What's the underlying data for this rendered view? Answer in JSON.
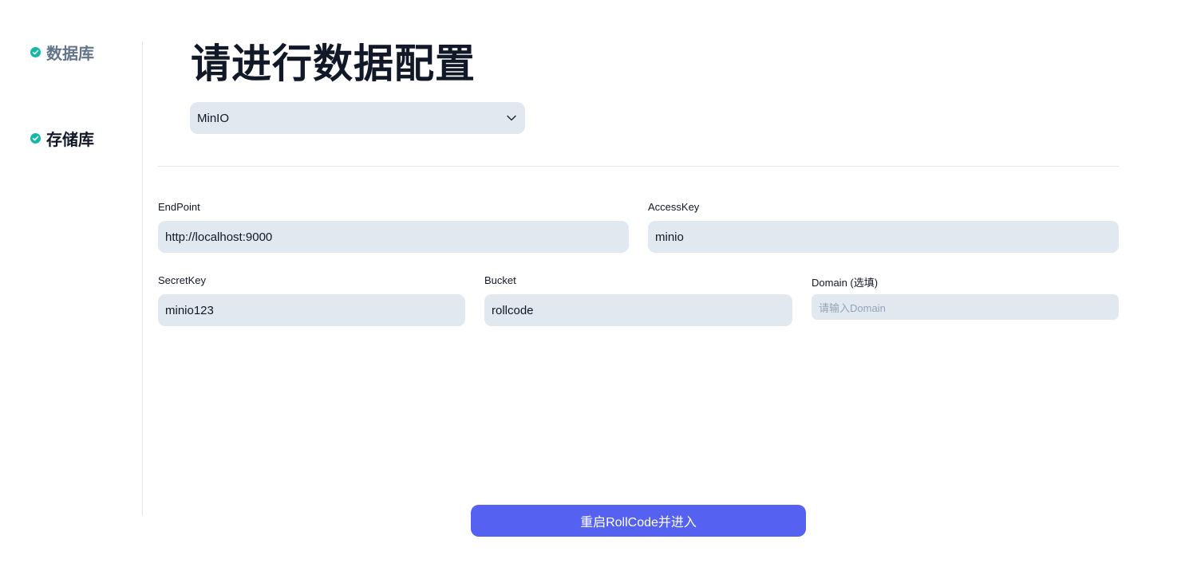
{
  "steps": [
    {
      "label": "数据库"
    },
    {
      "label": "存储库"
    }
  ],
  "title": "请进行数据配置",
  "storage_select": {
    "value": "MinIO"
  },
  "fields": {
    "endpoint": {
      "label": "EndPoint",
      "value": "http://localhost:9000"
    },
    "accesskey": {
      "label": "AccessKey",
      "value": "minio"
    },
    "secretkey": {
      "label": "SecretKey",
      "value": "minio123"
    },
    "bucket": {
      "label": "Bucket",
      "value": "rollcode"
    },
    "domain": {
      "label": "Domain (选填)",
      "placeholder": "请输入Domain",
      "value": ""
    }
  },
  "submit_label": "重启RollCode并进入",
  "colors": {
    "accent": "#5561f0",
    "check": "#14b8a6",
    "input_bg": "#e2e8f0"
  },
  "icons": {
    "step_done": "check-circle-icon",
    "select": "chevron-down-icon"
  }
}
